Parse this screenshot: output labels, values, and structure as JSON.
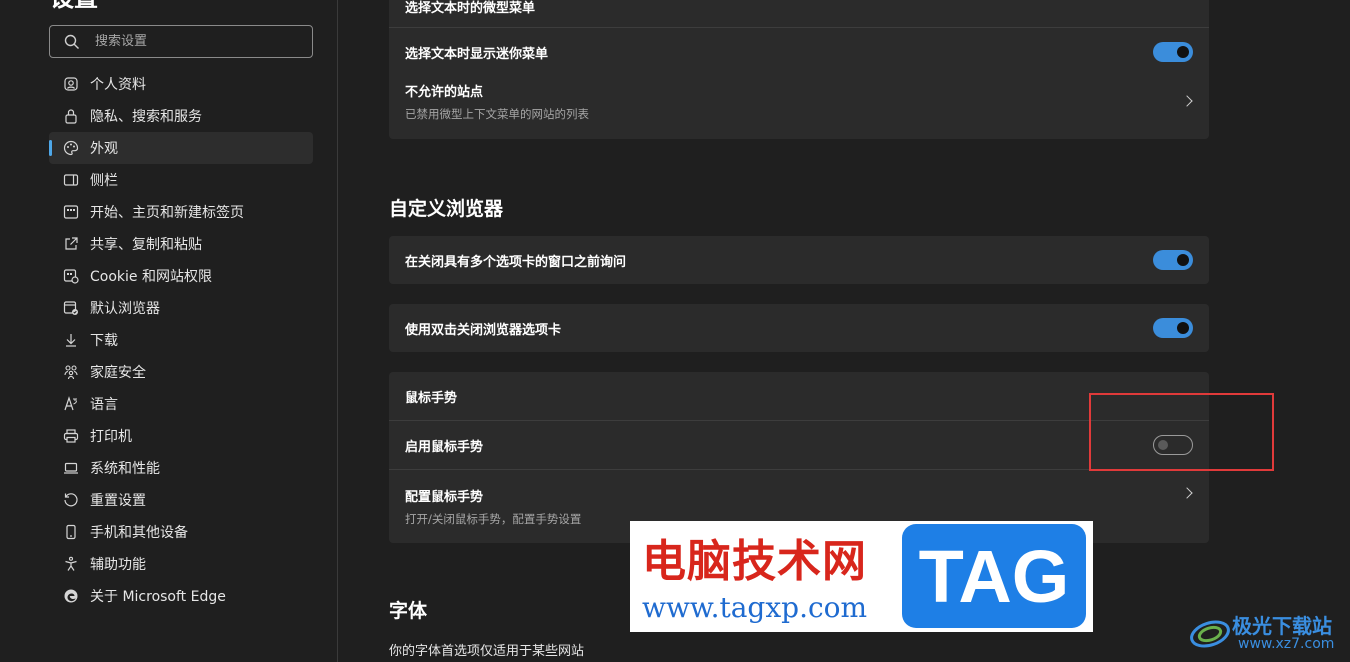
{
  "sidebar": {
    "title": "设置",
    "search_placeholder": "搜索设置",
    "items": [
      {
        "label": "个人资料",
        "icon": "profile-icon"
      },
      {
        "label": "隐私、搜索和服务",
        "icon": "lock-icon"
      },
      {
        "label": "外观",
        "icon": "palette-icon",
        "active": true
      },
      {
        "label": "侧栏",
        "icon": "sidebar-icon"
      },
      {
        "label": "开始、主页和新建标签页",
        "icon": "home-grid-icon"
      },
      {
        "label": "共享、复制和粘贴",
        "icon": "share-icon"
      },
      {
        "label": "Cookie 和网站权限",
        "icon": "cookie-icon"
      },
      {
        "label": "默认浏览器",
        "icon": "browser-icon"
      },
      {
        "label": "下载",
        "icon": "download-icon"
      },
      {
        "label": "家庭安全",
        "icon": "family-icon"
      },
      {
        "label": "语言",
        "icon": "language-icon"
      },
      {
        "label": "打印机",
        "icon": "printer-icon"
      },
      {
        "label": "系统和性能",
        "icon": "laptop-icon"
      },
      {
        "label": "重置设置",
        "icon": "reset-icon"
      },
      {
        "label": "手机和其他设备",
        "icon": "phone-icon"
      },
      {
        "label": "辅助功能",
        "icon": "accessibility-icon"
      },
      {
        "label": "关于 Microsoft Edge",
        "icon": "edge-icon"
      }
    ]
  },
  "main": {
    "card1": {
      "top_label": "选择文本时的微型菜单",
      "mini_menu_label": "选择文本时显示迷你菜单",
      "mini_menu_on": true,
      "blocked_sites_label": "不允许的站点",
      "blocked_sites_desc": "已禁用微型上下文菜单的网站的列表"
    },
    "customize_title": "自定义浏览器",
    "ask_before_close_label": "在关闭具有多个选项卡的窗口之前询问",
    "ask_before_close_on": true,
    "double_click_close_label": "使用双击关闭浏览器选项卡",
    "double_click_close_on": true,
    "mouse_gesture": {
      "header": "鼠标手势",
      "enable_label": "启用鼠标手势",
      "enable_on": false,
      "configure_label": "配置鼠标手势",
      "configure_desc": "打开/关闭鼠标手势，配置手势设置"
    },
    "font_title": "字体",
    "font_desc": "你的字体首选项仅适用于某些网站"
  },
  "watermark": {
    "cn_text": "电脑技术网",
    "url": "www.tagxp.com",
    "tag": "TAG",
    "site_cn": "极光下载站",
    "site_url": "www.xz7.com"
  },
  "colors": {
    "accent": "#3b8ddb",
    "highlight": "#e03a3a",
    "background": "#1f1f1f",
    "card": "#2b2b2b"
  }
}
